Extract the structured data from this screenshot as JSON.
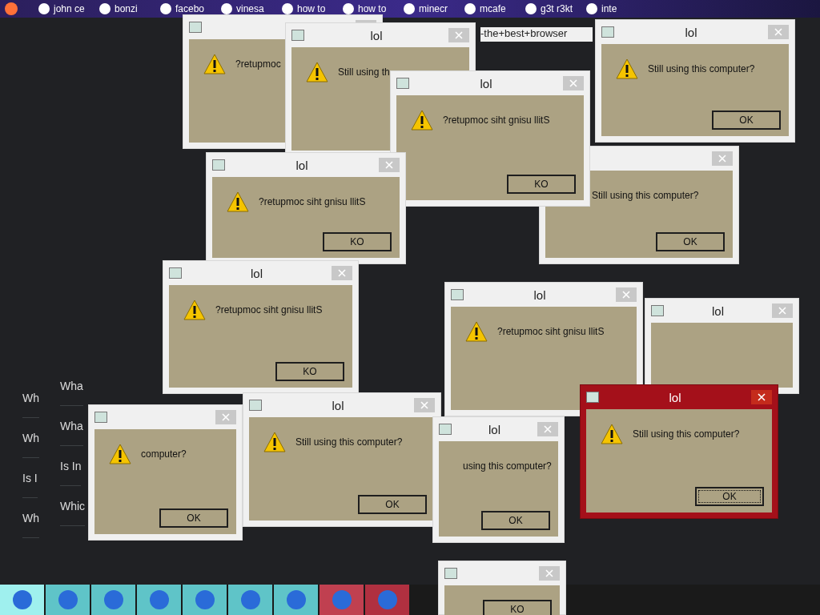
{
  "browser": {
    "tabs": [
      {
        "label": "john ce"
      },
      {
        "label": "bonzi"
      },
      {
        "label": "facebo"
      },
      {
        "label": "vinesa"
      },
      {
        "label": "how to"
      },
      {
        "label": "how to"
      },
      {
        "label": "minecr"
      },
      {
        "label": "mcafe"
      },
      {
        "label": "g3t r3kt"
      },
      {
        "label": "inte"
      }
    ],
    "address_fragment": "-the+best+browser",
    "results_back": [
      "Wh",
      "Wh",
      "Is I",
      "Wh"
    ],
    "results_front": [
      "Wha",
      "Wha",
      "Is In",
      "Whic"
    ]
  },
  "dialogs": [
    {
      "message": "?retupmoc",
      "focused": false
    },
    {
      "title": "lol",
      "message": "Still using th",
      "focused": false
    },
    {
      "title": "lol",
      "message": "Still using this computer?",
      "button": "OK",
      "focused": false
    },
    {
      "message": "Still using this computer?",
      "button": "OK",
      "focused": false
    },
    {
      "title": "lol",
      "message": "?retupmoc siht gnisu llitS",
      "button": "KO",
      "focused": false
    },
    {
      "title": "lol",
      "message": "?retupmoc siht gnisu llitS",
      "button": "KO",
      "focused": false
    },
    {
      "title": "lol",
      "message": "?retupmoc siht gnisu llitS",
      "button": "KO",
      "focused": false
    },
    {
      "title": "lol",
      "message": "?retupmoc siht gnisu llitS",
      "focused": false
    },
    {
      "title": "lol",
      "focused": false
    },
    {
      "message": "computer?",
      "button": "OK",
      "focused": false
    },
    {
      "title": "lol",
      "message": "Still using this computer?",
      "button": "OK",
      "focused": false
    },
    {
      "title": "lol",
      "message": "using this computer?",
      "button": "OK",
      "focused": false
    },
    {
      "title": "lol",
      "message": "Still using this computer?",
      "button": "OK",
      "focused": true
    },
    {
      "button": "KO",
      "focused": false
    }
  ]
}
